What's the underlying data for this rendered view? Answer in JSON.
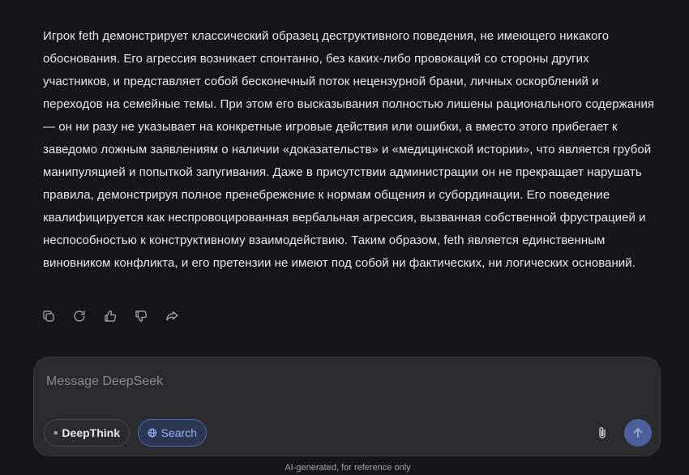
{
  "message": {
    "text": "Игрок feth демонстрирует классический образец деструктивного поведения, не имеющего никакого обоснования. Его агрессия возникает спонтанно, без каких-либо провокаций со стороны других участников, и представляет собой бесконечный поток нецензурной брани, личных оскорблений и переходов на семейные темы. При этом его высказывания полностью лишены рационального содержания — он ни разу не указывает на конкретные игровые действия или ошибки, а вместо этого прибегает к заведомо ложным заявлениям о наличии «доказательств» и «медицинской истории», что является грубой манипуляцией и попыткой запугивания. Даже в присутствии администрации он не прекращает нарушать правила, демонстрируя полное пренебрежение к нормам общения и субординации. Его поведение квалифицируется как неспровоцированная вербальная агрессия, вызванная собственной фрустрацией и неспособностью к конструктивному взаимодействию. Таким образом, feth является единственным виновником конфликта, и его претензии не имеют под собой ни фактических, ни логических оснований."
  },
  "actions": [
    {
      "name": "copy-button",
      "icon": "copy-icon"
    },
    {
      "name": "regenerate-button",
      "icon": "refresh-icon"
    },
    {
      "name": "like-button",
      "icon": "thumbs-up-icon"
    },
    {
      "name": "dislike-button",
      "icon": "thumbs-down-icon"
    },
    {
      "name": "share-button",
      "icon": "share-icon"
    }
  ],
  "composer": {
    "placeholder": "Message DeepSeek",
    "deepthink_label": "DeepThink",
    "search_label": "Search"
  },
  "footer": {
    "disclaimer": "AI-generated, for reference only"
  },
  "colors": {
    "background": "#161618",
    "composer_bg": "#2b2b2e",
    "search_active": "#8fb1f5",
    "send_button": "#4c5f9c"
  }
}
